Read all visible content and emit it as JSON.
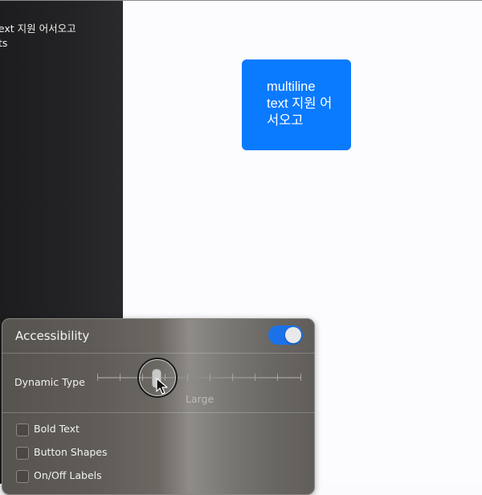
{
  "sidebar": {
    "items": [
      {
        "label": "text 지원 어서오고"
      },
      {
        "label": "ts"
      },
      {
        "label": "-"
      }
    ]
  },
  "preview": {
    "button_label": "multiline text 지원 어서오고",
    "accent_color": "#0a7aff"
  },
  "accessibility_panel": {
    "title": "Accessibility",
    "enabled": true,
    "dynamic_type": {
      "label": "Dynamic Type",
      "value_label": "Large",
      "position_fraction": 0.29
    },
    "checkboxes": [
      {
        "label": "Bold Text",
        "checked": false
      },
      {
        "label": "Button Shapes",
        "checked": false
      },
      {
        "label": "On/Off Labels",
        "checked": false
      }
    ]
  }
}
